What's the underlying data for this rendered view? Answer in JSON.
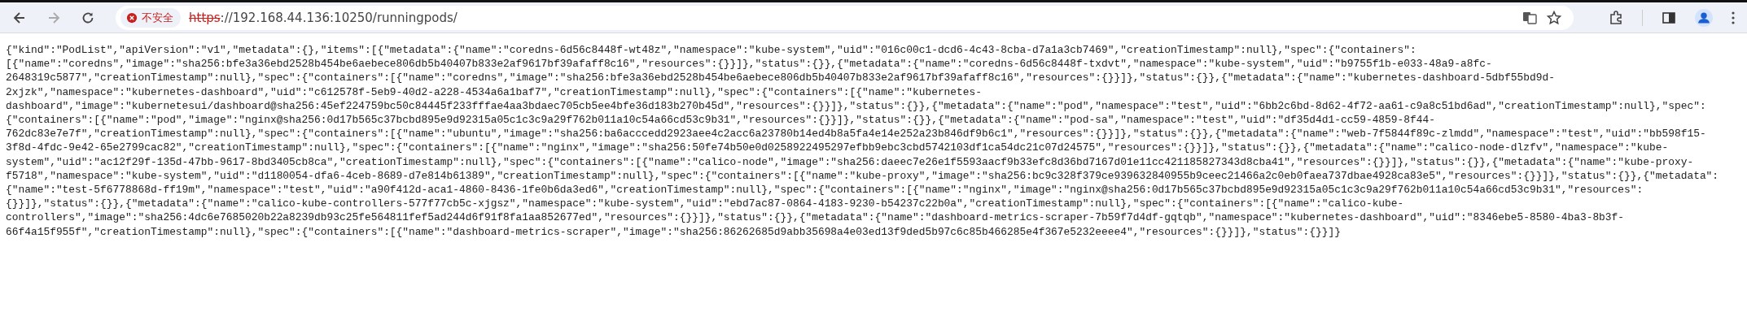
{
  "browser": {
    "security_label": "不安全",
    "url_scheme": "https",
    "url_rest": "://192.168.44.136:10250/runningpods/"
  },
  "body_lines": [
    "{\"kind\":\"PodList\",\"apiVersion\":\"v1\",\"metadata\":{},\"items\":[{\"metadata\":{\"name\":\"coredns-6d56c8448f-wt48z\",\"namespace\":\"kube-system\",\"uid\":\"016c00c1-dcd6-4c43-8cba-d7a1a3cb7469\",\"creationTimestamp\":null},\"spec\":{\"containers\":",
    "[{\"name\":\"coredns\",\"image\":\"sha256:bfe3a36ebd2528b454be6aebece806db5b40407b833e2af9617bf39afaff8c16\",\"resources\":{}}]},\"status\":{}},{\"metadata\":{\"name\":\"coredns-6d56c8448f-txdvt\",\"namespace\":\"kube-system\",\"uid\":\"b9755f1b-e033-48a9-a8fc-",
    "2648319c5877\",\"creationTimestamp\":null},\"spec\":{\"containers\":[{\"name\":\"coredns\",\"image\":\"sha256:bfe3a36ebd2528b454be6aebece806db5b40407b833e2af9617bf39afaff8c16\",\"resources\":{}}]},\"status\":{}},{\"metadata\":{\"name\":\"kubernetes-dashboard-5dbf55bd9d-",
    "2xjzk\",\"namespace\":\"kubernetes-dashboard\",\"uid\":\"c612578f-5eb9-40d2-a228-4534a6a1baf7\",\"creationTimestamp\":null},\"spec\":{\"containers\":[{\"name\":\"kubernetes-",
    "dashboard\",\"image\":\"kubernetesui/dashboard@sha256:45ef224759bc50c84445f233fffae4aa3bdaec705cb5ee4bfe36d183b270b45d\",\"resources\":{}}]},\"status\":{}},{\"metadata\":{\"name\":\"pod\",\"namespace\":\"test\",\"uid\":\"6bb2c6bd-8d62-4f72-aa61-c9a8c51bd6ad\",\"creationTimestamp\":null},\"spec\":",
    "{\"containers\":[{\"name\":\"pod\",\"image\":\"nginx@sha256:0d17b565c37bcbd895e9d92315a05c1c3c9a29f762b011a10c54a66cd53c9b31\",\"resources\":{}}]},\"status\":{}},{\"metadata\":{\"name\":\"pod-sa\",\"namespace\":\"test\",\"uid\":\"df35d4d1-cc59-4859-8f44-",
    "762dc83e7e7f\",\"creationTimestamp\":null},\"spec\":{\"containers\":[{\"name\":\"ubuntu\",\"image\":\"sha256:ba6acccedd2923aee4c2acc6a23780b14ed4b8a5fa4e14e252a23b846df9b6c1\",\"resources\":{}}]},\"status\":{}},{\"metadata\":{\"name\":\"web-7f5844f89c-zlmdd\",\"namespace\":\"test\",\"uid\":\"bb598f15-",
    "3f8d-4fdc-9e42-65e2799cac82\",\"creationTimestamp\":null},\"spec\":{\"containers\":[{\"name\":\"nginx\",\"image\":\"sha256:50fe74b50e0d0258922495297efbb9ebc3cbd5742103df1ca54dc21c07d24575\",\"resources\":{}}]},\"status\":{}},{\"metadata\":{\"name\":\"calico-node-dlzfv\",\"namespace\":\"kube-",
    "system\",\"uid\":\"ac12f29f-135d-47bb-9617-8bd3405cb8ca\",\"creationTimestamp\":null},\"spec\":{\"containers\":[{\"name\":\"calico-node\",\"image\":\"sha256:daeec7e26e1f5593aacf9b33efc8d36bd7167d01e11cc421185827343d8cba41\",\"resources\":{}}]},\"status\":{}},{\"metadata\":{\"name\":\"kube-proxy-",
    "f5718\",\"namespace\":\"kube-system\",\"uid\":\"d1180054-dfa6-4ceb-8689-d7e814b61389\",\"creationTimestamp\":null},\"spec\":{\"containers\":[{\"name\":\"kube-proxy\",\"image\":\"sha256:bc9c328f379ce939632840955b9ceec21466a2c0eb0faea737dbae4928ca83e5\",\"resources\":{}}]},\"status\":{}},{\"metadata\":",
    "{\"name\":\"test-5f6778868d-ff19m\",\"namespace\":\"test\",\"uid\":\"a90f412d-aca1-4860-8436-1fe0b6da3ed6\",\"creationTimestamp\":null},\"spec\":{\"containers\":[{\"name\":\"nginx\",\"image\":\"nginx@sha256:0d17b565c37bcbd895e9d92315a05c1c3c9a29f762b011a10c54a66cd53c9b31\",\"resources\":",
    "{}}]},\"status\":{}},{\"metadata\":{\"name\":\"calico-kube-controllers-577f77cb5c-xjgsz\",\"namespace\":\"kube-system\",\"uid\":\"ebd7ac87-0864-4183-9230-b54237c22b0a\",\"creationTimestamp\":null},\"spec\":{\"containers\":[{\"name\":\"calico-kube-",
    "controllers\",\"image\":\"sha256:4dc6e7685020b22a8239db93c25fe564811fef5ad244d6f91f8fa1aa852677ed\",\"resources\":{}}]},\"status\":{}},{\"metadata\":{\"name\":\"dashboard-metrics-scraper-7b59f7d4df-gqtqb\",\"namespace\":\"kubernetes-dashboard\",\"uid\":\"8346ebe5-8580-4ba3-8b3f-",
    "66f4a15f955f\",\"creationTimestamp\":null},\"spec\":{\"containers\":[{\"name\":\"dashboard-metrics-scraper\",\"image\":\"sha256:86262685d9abb35698a4e03ed13f9ded5b97c6c85b466285e4f367e5232eeee4\",\"resources\":{}}]},\"status\":{}}]}"
  ]
}
